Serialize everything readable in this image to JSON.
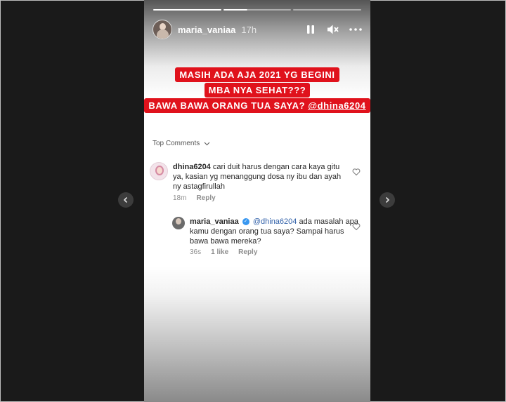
{
  "story": {
    "username": "maria_vaniaa",
    "time": "17h",
    "progress_segments": [
      1,
      0.35,
      0
    ]
  },
  "captions": {
    "line1": "MASIH ADA AJA 2021 YG BEGINI",
    "line2": "MBA NYA SEHAT???",
    "line3_prefix": "BAWA BAWA ORANG TUA SAYA? ",
    "line3_mention": "@dhina6204"
  },
  "comments_header": {
    "label": "Top Comments"
  },
  "comments": [
    {
      "username": "dhina6204",
      "text": "cari duit harus dengan cara kaya gitu ya, kasian yg menanggung dosa ny ibu dan ayah ny astagfirullah",
      "time": "18m",
      "reply_label": "Reply"
    },
    {
      "username": "maria_vaniaa",
      "mention": "@dhina6204",
      "text": "ada masalah apa kamu dengan orang tua saya? Sampai harus bawa bawa mereka?",
      "time": "36s",
      "likes": "1 like",
      "reply_label": "Reply"
    }
  ],
  "icons": {
    "pause": "pause-icon",
    "mute": "mute-icon",
    "more": "more-icon",
    "heart": "heart-icon",
    "chevron": "chevron-down-icon",
    "verified": "verified-icon",
    "prev": "chevron-left-icon",
    "next": "chevron-right-icon"
  },
  "colors": {
    "caption_bg": "#e0121c",
    "verified": "#3897f0",
    "mention": "#2f5fa8"
  }
}
